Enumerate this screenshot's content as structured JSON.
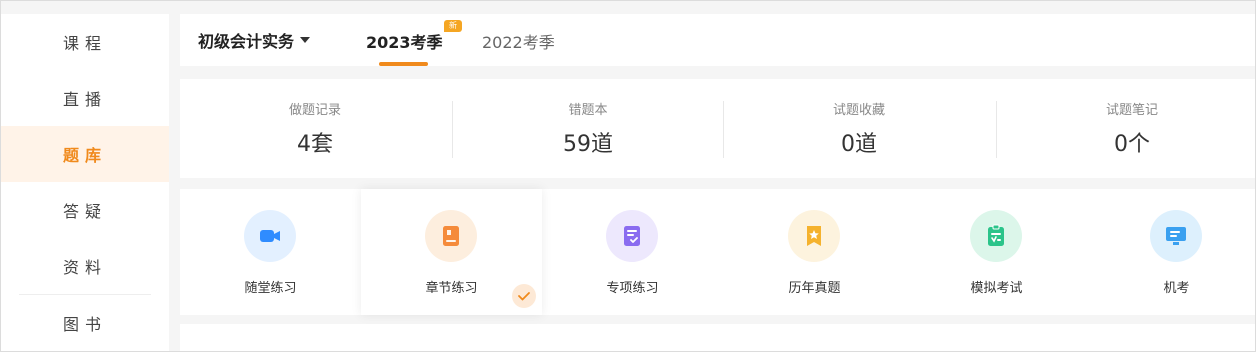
{
  "sidebar": {
    "items": [
      {
        "label": "课程"
      },
      {
        "label": "直播"
      },
      {
        "label": "题库",
        "active": true
      },
      {
        "label": "答疑"
      },
      {
        "label": "资料"
      },
      {
        "label": "图书"
      }
    ]
  },
  "header": {
    "subject": "初级会计实务",
    "tabs": [
      {
        "label": "2023考季",
        "active": true,
        "badge": "新"
      },
      {
        "label": "2022考季"
      }
    ]
  },
  "stats": [
    {
      "label": "做题记录",
      "value": "4套"
    },
    {
      "label": "错题本",
      "value": "59道"
    },
    {
      "label": "试题收藏",
      "value": "0道"
    },
    {
      "label": "试题笔记",
      "value": "0个"
    }
  ],
  "practice": [
    {
      "label": "随堂练习",
      "icon": "video-camera-icon",
      "color": "#2f8cff"
    },
    {
      "label": "章节练习",
      "icon": "book-icon",
      "color": "#f58b3b",
      "selected": true
    },
    {
      "label": "专项练习",
      "icon": "checklist-document-icon",
      "color": "#8a6cf0"
    },
    {
      "label": "历年真题",
      "icon": "star-bookmark-icon",
      "color": "#f5b22d"
    },
    {
      "label": "模拟考试",
      "icon": "exam-clipboard-icon",
      "color": "#2bc48a"
    },
    {
      "label": "机考",
      "icon": "computer-monitor-icon",
      "color": "#3aa0f0"
    }
  ],
  "colors": {
    "accent": "#f08a1c",
    "sidebar_active_bg": "#fff3e8"
  }
}
